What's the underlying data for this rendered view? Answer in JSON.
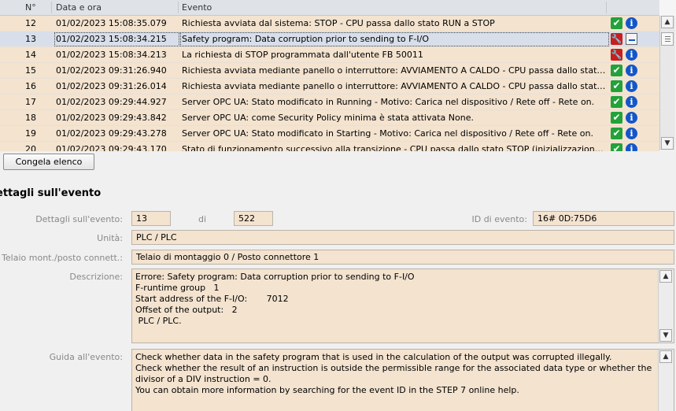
{
  "table": {
    "columns": {
      "num": "N°",
      "date": "Data e ora",
      "event": "Evento"
    },
    "rows": [
      {
        "num": "12",
        "date": "01/02/2023 15:08:35.079",
        "event": "Richiesta avviata dal sistema: STOP  - CPU passa dallo stato RUN a STOP",
        "icon1": "status-ok-icon",
        "icon2": "info-icon"
      },
      {
        "num": "13",
        "date": "01/02/2023 15:08:34.215",
        "event": "Safety program: Data corruption prior to sending to F-I/O",
        "icon1": "error-icon",
        "icon2": "acknowledge-icon",
        "selected": true
      },
      {
        "num": "14",
        "date": "01/02/2023 15:08:34.213",
        "event": "La richiesta di STOP programmata dall'utente FB 50011",
        "icon1": "error-icon",
        "icon2": "info-icon"
      },
      {
        "num": "15",
        "date": "01/02/2023 09:31:26.940",
        "event": "Richiesta avviata mediante panello o interruttore: AVVIAMENTO A CALDO  - CPU passa dallo stato AVVIAMENTO",
        "icon1": "status-ok-icon",
        "icon2": "info-icon"
      },
      {
        "num": "16",
        "date": "01/02/2023 09:31:26.014",
        "event": "Richiesta avviata mediante panello o interruttore: AVVIAMENTO A CALDO  - CPU passa dallo stato STOP",
        "icon1": "status-ok-icon",
        "icon2": "info-icon"
      },
      {
        "num": "17",
        "date": "01/02/2023 09:29:44.927",
        "event": "Server OPC UA: Stato modificato in Running - Motivo: Carica nel dispositivo / Rete off - Rete on.",
        "icon1": "status-ok-icon",
        "icon2": "info-icon"
      },
      {
        "num": "18",
        "date": "01/02/2023 09:29:43.842",
        "event": "Server OPC UA: come Security Policy minima è stata attivata None.",
        "icon1": "status-ok-icon",
        "icon2": "info-icon"
      },
      {
        "num": "19",
        "date": "01/02/2023 09:29:43.278",
        "event": "Server OPC UA: Stato modificato in Starting - Motivo: Carica nel dispositivo / Rete off - Rete on.",
        "icon1": "status-ok-icon",
        "icon2": "info-icon"
      },
      {
        "num": "20",
        "date": "01/02/2023 09:29:43.170",
        "event": "Stato di funzionamento successivo alla transizione  - CPU passa dallo stato STOP (inizializzazione) a STOP",
        "icon1": "status-ok-icon",
        "icon2": "info-icon"
      }
    ]
  },
  "freeze_button": "Congela elenco",
  "details": {
    "title": "ettagli sull'evento",
    "event_details_label": "Dettagli sull'evento:",
    "event_index": "13",
    "of_label": "di",
    "event_total": "522",
    "event_id_label": "ID di evento:",
    "event_id": "16# 0D:75D6",
    "unit_label": "Unità:",
    "unit": "PLC / PLC",
    "rack_label": "Telaio mont./posto connett.:",
    "rack": "Telaio di montaggio 0 / Posto connettore 1",
    "description_label": "Descrizione:",
    "description_lines": [
      "Errore: Safety program: Data corruption prior to sending to F-I/O",
      "F-runtime group   1",
      "Start address of the F-I/O:       7012",
      "Offset of the output:   2",
      " PLC / PLC."
    ],
    "help_label": "Guida all'evento:",
    "help_lines": [
      "Check whether data in the safety program that is used in the calculation of the output was corrupted illegally.",
      "Check whether the result of an instruction is outside the permissible range for the associated data type or whether the divisor of a DIV instruction = 0.",
      "You can obtain more information by searching for the event ID in the STEP 7 online help."
    ]
  },
  "icons": {
    "status_ok": "checkmark",
    "error": "wrench",
    "info": "i",
    "acknowledge": "ack-arrow",
    "scroll_up": "chevron-up",
    "scroll_down": "chevron-down"
  },
  "colors": {
    "row_background": "#f3e3cf",
    "selected_row": "#d8dfea",
    "ok_green": "#22a23a",
    "error_red": "#c81e1e",
    "info_blue": "#1456c8"
  }
}
